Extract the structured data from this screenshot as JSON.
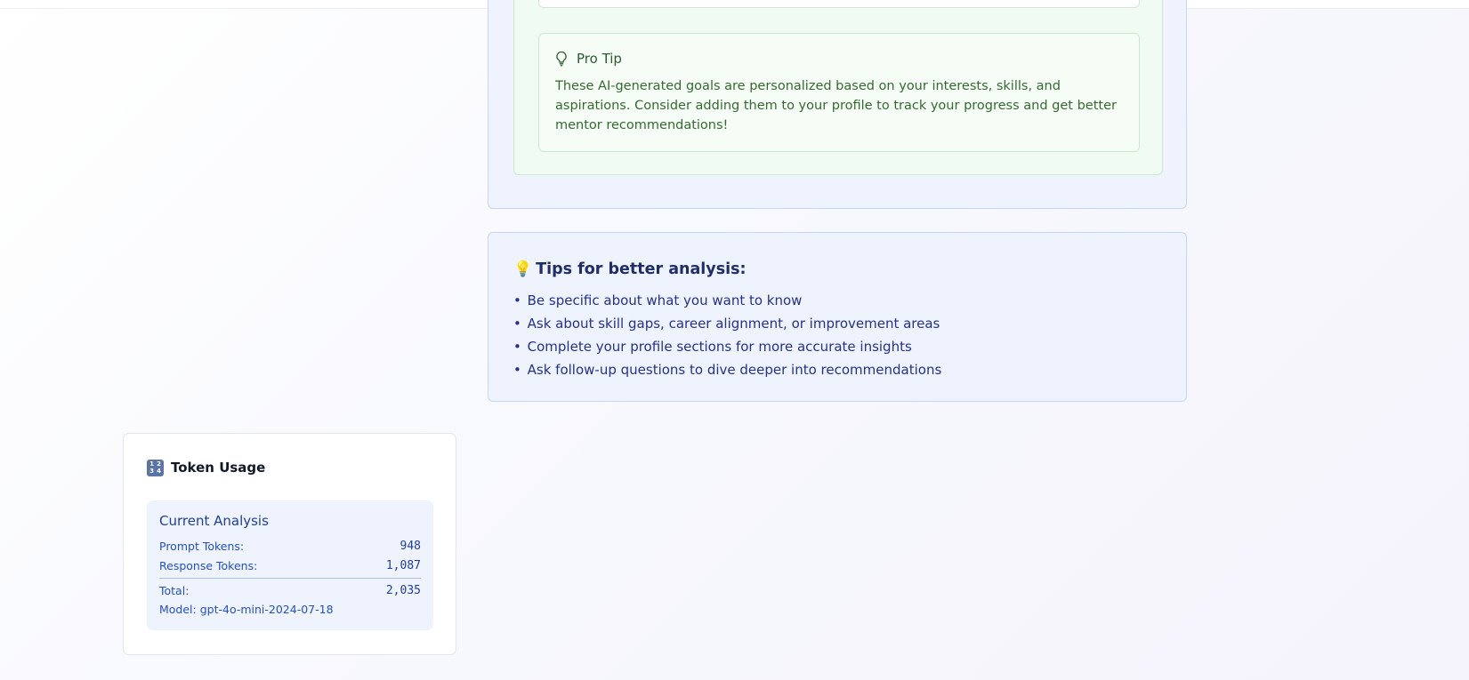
{
  "pro_tip": {
    "icon": "lightbulb-outline-icon",
    "title": "Pro Tip",
    "body": "These AI-generated goals are personalized based on your interests, skills, and aspirations. Consider adding them to your profile to track your progress and get better mentor recommendations!"
  },
  "tips": {
    "icon": "💡",
    "title": "Tips for better analysis:",
    "items": [
      "Be specific about what you want to know",
      "Ask about skill gaps, career alignment, or improvement areas",
      "Complete your profile sections for more accurate insights",
      "Ask follow-up questions to dive deeper into recommendations"
    ],
    "bullet": "•"
  },
  "token_usage": {
    "icon": "input-numbers-icon",
    "title": "Token Usage",
    "current_analysis": {
      "title": "Current Analysis",
      "prompt_label": "Prompt Tokens:",
      "prompt_value": "948",
      "response_label": "Response Tokens:",
      "response_value": "1,087",
      "total_label": "Total:",
      "total_value": "2,035",
      "model": "Model: gpt-4o-mini-2024-07-18"
    }
  },
  "colors": {
    "accent_blue": "#1f3f9b",
    "tip_green": "#336b2e",
    "card_blue_bg": "#eef3fe",
    "card_green_bg": "#f0fbf1"
  }
}
